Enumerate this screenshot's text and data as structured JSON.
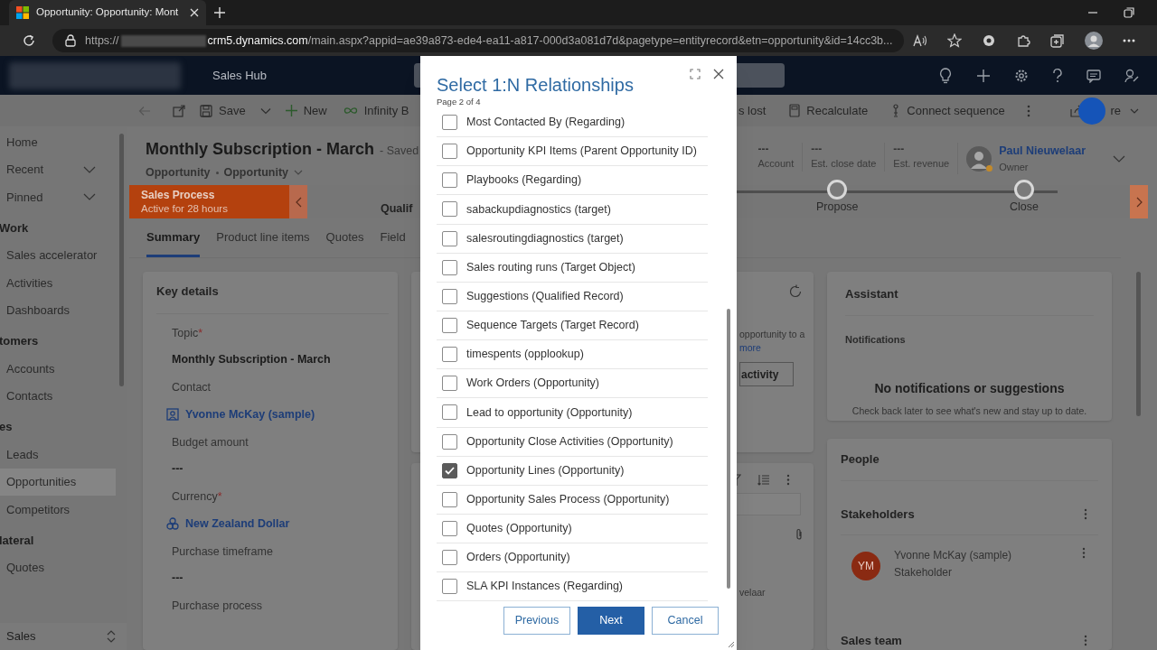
{
  "browser": {
    "tab_title": "Opportunity: Opportunity: Mont",
    "url_scheme": "https://",
    "url_host": "crm5.dynamics.com",
    "url_path": "/main.aspx?appid=ae39a873-ede4-ea11-a817-000d3a081d7d&pagetype=entityrecord&etn=opportunity&id=14cc3b..."
  },
  "app": {
    "title": "Sales Hub"
  },
  "commands_left": [
    {
      "kind": "back"
    },
    {
      "kind": "popout"
    },
    {
      "kind": "save",
      "label": "Save"
    },
    {
      "kind": "split"
    },
    {
      "kind": "new",
      "label": "New"
    },
    {
      "kind": "infinity",
      "label": "Infinity B"
    }
  ],
  "commands_right": [
    {
      "kind": "plain",
      "label": "s lost"
    },
    {
      "kind": "calc",
      "label": "Recalculate"
    },
    {
      "kind": "sequence",
      "label": "Connect sequence"
    },
    {
      "kind": "more"
    }
  ],
  "share": {
    "label": "re"
  },
  "nav": [
    {
      "items": [
        {
          "kind": "link",
          "label": "Home",
          "selected": false
        },
        {
          "kind": "menu",
          "label": "Recent",
          "selected": false
        },
        {
          "kind": "menu",
          "label": "Pinned",
          "selected": false
        }
      ]
    },
    {
      "heading": "Work",
      "items": [
        {
          "kind": "link",
          "label": "Sales accelerator",
          "selected": false
        },
        {
          "kind": "link",
          "label": "Activities",
          "selected": false
        },
        {
          "kind": "link",
          "label": "Dashboards",
          "selected": false
        }
      ]
    },
    {
      "heading": "tomers",
      "items": [
        {
          "kind": "link",
          "label": "Accounts",
          "selected": false
        },
        {
          "kind": "link",
          "label": "Contacts",
          "selected": false
        }
      ]
    },
    {
      "heading": "es",
      "items": [
        {
          "kind": "link",
          "label": "Leads",
          "selected": false
        },
        {
          "kind": "link",
          "label": "Opportunities",
          "selected": true
        },
        {
          "kind": "link",
          "label": "Competitors",
          "selected": false
        }
      ]
    },
    {
      "heading": "lateral",
      "items": [
        {
          "kind": "link",
          "label": "Quotes",
          "selected": false
        }
      ]
    }
  ],
  "area": {
    "label": "Sales"
  },
  "record": {
    "title": "Monthly Subscription - March",
    "status": "- Saved",
    "entity": "Opportunity",
    "form": "Opportunity",
    "header_fields": [
      {
        "value": "---",
        "label": "Account"
      },
      {
        "value": "---",
        "label": "Est. close date"
      },
      {
        "value": "---",
        "label": "Est. revenue"
      }
    ],
    "owner": {
      "name": "Paul Nieuwelaar",
      "role": "Owner"
    }
  },
  "process": {
    "name": "Sales Process",
    "duration": "Active for 28 hours",
    "stages": [
      {
        "label": "Qualif",
        "active": true
      },
      {
        "label": "Propose",
        "active": false
      },
      {
        "label": "Close",
        "active": false
      }
    ]
  },
  "tabs": [
    {
      "label": "Summary",
      "selected": true
    },
    {
      "label": "Product line items",
      "selected": false
    },
    {
      "label": "Quotes",
      "selected": false
    },
    {
      "label": "Field",
      "selected": false
    }
  ],
  "key_details": {
    "title": "Key details",
    "fields": [
      {
        "label": "Topic",
        "required": true,
        "kind": "text",
        "value": "Monthly Subscription - March"
      },
      {
        "label": "Contact",
        "required": false,
        "kind": "contact",
        "value": "Yvonne McKay (sample)"
      },
      {
        "label": "Budget amount",
        "required": false,
        "kind": "text",
        "value": "---"
      },
      {
        "label": "Currency",
        "required": true,
        "kind": "currency",
        "value": "New Zealand Dollar"
      },
      {
        "label": "Purchase timeframe",
        "required": false,
        "kind": "text",
        "value": "---"
      },
      {
        "label": "Purchase process",
        "required": false
      }
    ],
    "required_mark": "*"
  },
  "timeline": {
    "text": "opportunity to a",
    "link": "more",
    "button": "activity",
    "owner_fragment": "velaar"
  },
  "assistant": {
    "title": "Assistant",
    "section": "Notifications",
    "empty_title": "No notifications or suggestions",
    "empty_text": "Check back later to see what's new and stay up to date."
  },
  "people": {
    "title": "People",
    "stakeholders_title": "Stakeholders",
    "stakeholders": [
      {
        "initials": "YM",
        "name": "Yvonne McKay (sample)",
        "role": "Stakeholder"
      }
    ],
    "sales_team_title": "Sales team"
  },
  "dialog": {
    "title": "Select 1:N Relationships",
    "page": "Page 2 of 4",
    "items": [
      {
        "label": "Most Contacted By (Regarding)",
        "checked": false
      },
      {
        "label": "Opportunity KPI Items (Parent Opportunity ID)",
        "checked": false
      },
      {
        "label": "Playbooks (Regarding)",
        "checked": false
      },
      {
        "label": "sabackupdiagnostics (target)",
        "checked": false
      },
      {
        "label": "salesroutingdiagnostics (target)",
        "checked": false
      },
      {
        "label": "Sales routing runs (Target Object)",
        "checked": false
      },
      {
        "label": "Suggestions (Qualified Record)",
        "checked": false
      },
      {
        "label": "Sequence Targets (Target Record)",
        "checked": false
      },
      {
        "label": "timespents (opplookup)",
        "checked": false
      },
      {
        "label": "Work Orders (Opportunity)",
        "checked": false
      },
      {
        "label": "Lead to opportunity (Opportunity)",
        "checked": false
      },
      {
        "label": "Opportunity Close Activities (Opportunity)",
        "checked": false
      },
      {
        "label": "Opportunity Lines (Opportunity)",
        "checked": true
      },
      {
        "label": "Opportunity Sales Process (Opportunity)",
        "checked": false
      },
      {
        "label": "Quotes (Opportunity)",
        "checked": false
      },
      {
        "label": "Orders (Opportunity)",
        "checked": false
      },
      {
        "label": "SLA KPI Instances (Regarding)",
        "checked": false
      }
    ],
    "buttons": [
      {
        "label": "Previous",
        "primary": false
      },
      {
        "label": "Next",
        "primary": true
      },
      {
        "label": "Cancel",
        "primary": false
      }
    ]
  }
}
